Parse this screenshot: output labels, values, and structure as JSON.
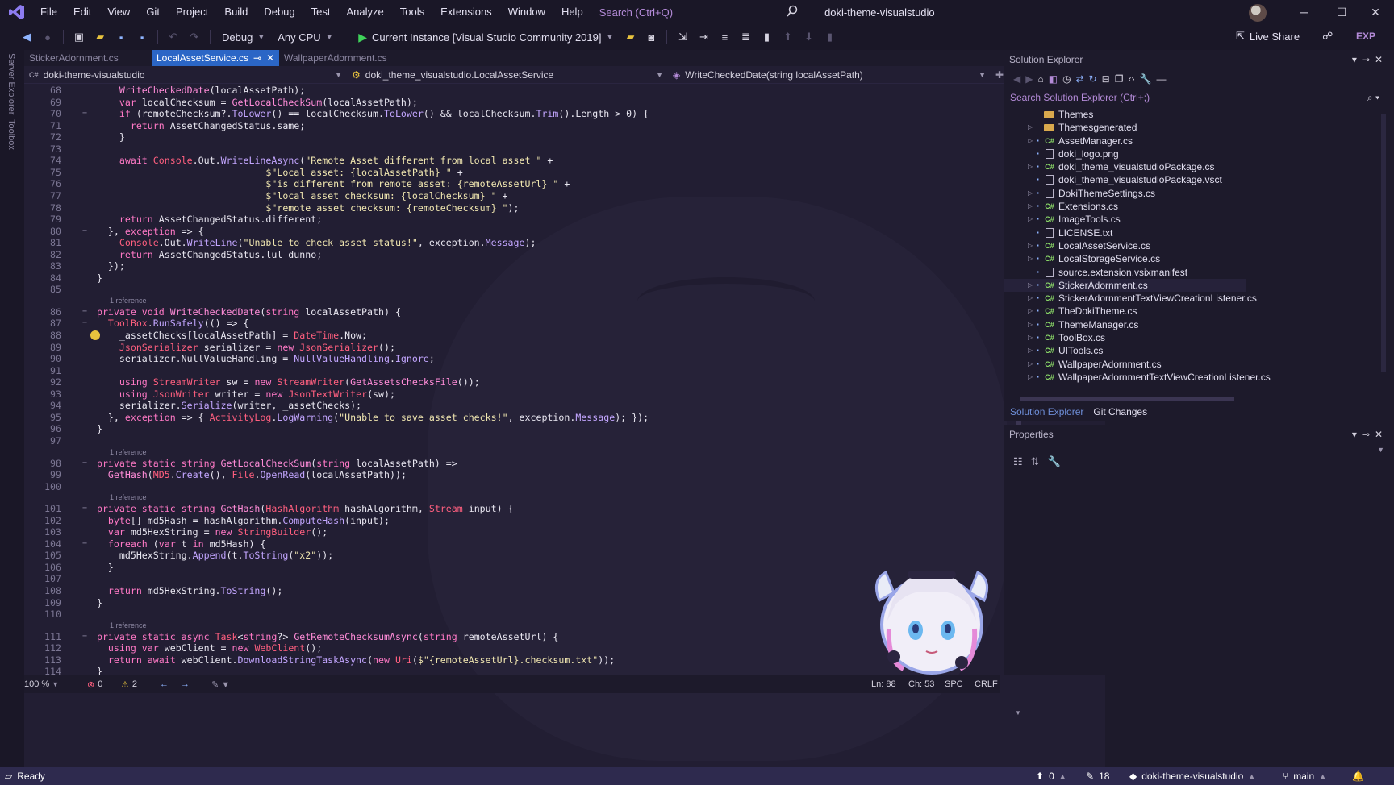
{
  "title_bar": {
    "menu": [
      "File",
      "Edit",
      "View",
      "Git",
      "Project",
      "Build",
      "Debug",
      "Test",
      "Analyze",
      "Tools",
      "Extensions",
      "Window",
      "Help"
    ],
    "search_placeholder": "Search (Ctrl+Q)",
    "solution_name": "doki-theme-visualstudio",
    "controls": {
      "minimize": "─",
      "maximize": "☐",
      "close": "✕"
    }
  },
  "toolbar": {
    "configuration": "Debug",
    "platform": "Any CPU",
    "run_target": "Current Instance [Visual Studio Community 2019]",
    "live_share": "Live Share",
    "exp_badge": "EXP"
  },
  "side_tabs": [
    "Server Explorer",
    "Toolbox"
  ],
  "editor": {
    "tabs": [
      {
        "label": "StickerAdornment.cs",
        "active": false
      },
      {
        "label": "LocalAssetService.cs",
        "active": true
      },
      {
        "label": "WallpaperAdornment.cs",
        "active": false
      }
    ],
    "nav": {
      "project": "doki-theme-visualstudio",
      "class": "doki_theme_visualstudio.LocalAssetService",
      "member": "WriteCheckedDate(string localAssetPath)"
    },
    "references_label": "1 reference",
    "lines": [
      {
        "n": "68",
        "html": "      <span class='fn'>WriteCheckedDate</span>(localAssetPath);"
      },
      {
        "n": "69",
        "html": "      <span class='kw'>var</span> localChecksum = <span class='fn'>GetLocalCheckSum</span>(localAssetPath);"
      },
      {
        "n": "70",
        "html": "      <span class='kw'>if</span> (remoteChecksum?.<span class='mm'>ToLower</span>() == localChecksum.<span class='mm'>ToLower</span>() &amp;&amp; localChecksum.<span class='mm'>Trim</span>().Length &gt; 0) {",
        "fold": true
      },
      {
        "n": "71",
        "html": "        <span class='kw'>return</span> AssetChangedStatus.same;"
      },
      {
        "n": "72",
        "html": "      }"
      },
      {
        "n": "73",
        "html": ""
      },
      {
        "n": "74",
        "html": "      <span class='kw'>await</span> <span class='ty'>Console</span>.Out.<span class='mm'>WriteLineAsync</span>(<span class='str'>\"Remote Asset different from local asset \"</span> +"
      },
      {
        "n": "75",
        "html": "                                <span class='str'>$\"Local asset: {localAssetPath} \"</span> +"
      },
      {
        "n": "76",
        "html": "                                <span class='str'>$\"is different from remote asset: {remoteAssetUrl} \"</span> +"
      },
      {
        "n": "77",
        "html": "                                <span class='str'>$\"local asset checksum: {localChecksum} \"</span> +"
      },
      {
        "n": "78",
        "html": "                                <span class='str'>$\"remote asset checksum: {remoteChecksum} \"</span>);"
      },
      {
        "n": "79",
        "html": "      <span class='kw'>return</span> AssetChangedStatus.different;"
      },
      {
        "n": "80",
        "html": "    }, <span class='kw'>exception</span> =&gt; {",
        "fold": true
      },
      {
        "n": "81",
        "html": "      <span class='ty'>Console</span>.Out.<span class='mm'>WriteLine</span>(<span class='str'>\"Unable to check asset status!\"</span>, exception.<span class='mm'>Message</span>);"
      },
      {
        "n": "82",
        "html": "      <span class='kw'>return</span> AssetChangedStatus.lul_dunno;"
      },
      {
        "n": "83",
        "html": "    });"
      },
      {
        "n": "84",
        "html": "  }"
      },
      {
        "n": "85",
        "html": ""
      },
      {
        "n": "86",
        "html": "  <span class='kw'>private void</span> <span class='fn'>WriteCheckedDate</span>(<span class='kw'>string</span> localAssetPath) {",
        "fold": true,
        "ref": true
      },
      {
        "n": "87",
        "html": "    <span class='ty'>ToolBox</span>.<span class='mm'>RunSafely</span>(() =&gt; {",
        "fold": true
      },
      {
        "n": "88",
        "html": "      _assetChecks[localAssetPath] = <span class='ty'>DateTime</span>.Now;",
        "bulb": true
      },
      {
        "n": "89",
        "html": "      <span class='ty'>JsonSerializer</span> serializer = <span class='kw'>new</span> <span class='ty'>JsonSerializer</span>();"
      },
      {
        "n": "90",
        "html": "      serializer.NullValueHandling = <span class='mm'>NullValueHandling</span>.<span class='mm'>Ignore</span>;"
      },
      {
        "n": "91",
        "html": ""
      },
      {
        "n": "92",
        "html": "      <span class='kw'>using</span> <span class='ty'>StreamWriter</span> sw = <span class='kw'>new</span> <span class='ty'>StreamWriter</span>(<span class='fn'>GetAssetsChecksFile</span>());"
      },
      {
        "n": "93",
        "html": "      <span class='kw'>using</span> <span class='ty'>JsonWriter</span> writer = <span class='kw'>new</span> <span class='ty'>JsonTextWriter</span>(sw);"
      },
      {
        "n": "94",
        "html": "      serializer.<span class='mm'>Serialize</span>(writer, _assetChecks);"
      },
      {
        "n": "95",
        "html": "    }, <span class='kw'>exception</span> =&gt; { <span class='ty'>ActivityLog</span>.<span class='mm'>LogWarning</span>(<span class='str'>\"Unable to save asset checks!\"</span>, exception.<span class='mm'>Message</span>); });"
      },
      {
        "n": "96",
        "html": "  }"
      },
      {
        "n": "97",
        "html": ""
      },
      {
        "n": "98",
        "html": "  <span class='kw'>private static string</span> <span class='fn'>GetLocalCheckSum</span>(<span class='kw'>string</span> localAssetPath) =&gt;",
        "fold": true,
        "ref": true
      },
      {
        "n": "99",
        "html": "    <span class='fn'>GetHash</span>(<span class='ty'>MD5</span>.<span class='mm'>Create</span>(), <span class='ty'>File</span>.<span class='mm'>OpenRead</span>(localAssetPath));"
      },
      {
        "n": "100",
        "html": ""
      },
      {
        "n": "101",
        "html": "  <span class='kw'>private static string</span> <span class='fn'>GetHash</span>(<span class='ty'>HashAlgorithm</span> hashAlgorithm, <span class='ty'>Stream</span> input) {",
        "fold": true,
        "ref": true
      },
      {
        "n": "102",
        "html": "    <span class='kw'>byte</span>[] md5Hash = hashAlgorithm.<span class='mm'>ComputeHash</span>(input);"
      },
      {
        "n": "103",
        "html": "    <span class='kw'>var</span> md5HexString = <span class='kw'>new</span> <span class='ty'>StringBuilder</span>();"
      },
      {
        "n": "104",
        "html": "    <span class='kw'>foreach</span> (<span class='kw'>var</span> t <span class='kw'>in</span> md5Hash) {",
        "fold": true
      },
      {
        "n": "105",
        "html": "      md5HexString.<span class='mm'>Append</span>(t.<span class='mm'>ToString</span>(<span class='str'>\"x2\"</span>));"
      },
      {
        "n": "106",
        "html": "    }"
      },
      {
        "n": "107",
        "html": ""
      },
      {
        "n": "108",
        "html": "    <span class='kw'>return</span> md5HexString.<span class='mm'>ToString</span>();"
      },
      {
        "n": "109",
        "html": "  }"
      },
      {
        "n": "110",
        "html": ""
      },
      {
        "n": "111",
        "html": "  <span class='kw'>private static async</span> <span class='ty'>Task</span>&lt;<span class='kw'>string</span>?&gt; <span class='fn'>GetRemoteChecksumAsync</span>(<span class='kw'>string</span> remoteAssetUrl) {",
        "fold": true,
        "ref": true
      },
      {
        "n": "112",
        "html": "    <span class='kw'>using var</span> webClient = <span class='kw'>new</span> <span class='ty'>WebClient</span>();"
      },
      {
        "n": "113",
        "html": "    <span class='kw'>return await</span> webClient.<span class='mm'>DownloadStringTaskAsync</span>(<span class='kw'>new</span> <span class='ty'>Uri</span>(<span class='str'>$\"{remoteAssetUrl}.checksum.txt\"</span>));"
      },
      {
        "n": "114",
        "html": "  }"
      }
    ],
    "zoom": "100 %",
    "errors": "0",
    "warnings": "2",
    "position": {
      "ln": "Ln: 88",
      "ch": "Ch: 53",
      "spc": "SPC",
      "eol": "CRLF"
    }
  },
  "solution_explorer": {
    "title": "Solution Explorer",
    "search_placeholder": "Search Solution Explorer (Ctrl+;)",
    "items": [
      {
        "label": "Themes",
        "kind": "folder",
        "arrow": false
      },
      {
        "label": "Themesgenerated",
        "kind": "folder",
        "arrow": true
      },
      {
        "label": "AssetManager.cs",
        "kind": "cs",
        "arrow": true
      },
      {
        "label": "doki_logo.png",
        "kind": "file",
        "arrow": false
      },
      {
        "label": "doki_theme_visualstudioPackage.cs",
        "kind": "cs",
        "arrow": true
      },
      {
        "label": "doki_theme_visualstudioPackage.vsct",
        "kind": "file",
        "arrow": false
      },
      {
        "label": "DokiThemeSettings.cs",
        "kind": "file",
        "arrow": true
      },
      {
        "label": "Extensions.cs",
        "kind": "cs",
        "arrow": true
      },
      {
        "label": "ImageTools.cs",
        "kind": "cs",
        "arrow": true
      },
      {
        "label": "LICENSE.txt",
        "kind": "file",
        "arrow": false
      },
      {
        "label": "LocalAssetService.cs",
        "kind": "cs",
        "arrow": true
      },
      {
        "label": "LocalStorageService.cs",
        "kind": "cs",
        "arrow": true
      },
      {
        "label": "source.extension.vsixmanifest",
        "kind": "file",
        "arrow": false
      },
      {
        "label": "StickerAdornment.cs",
        "kind": "cs",
        "arrow": true,
        "selected": true
      },
      {
        "label": "StickerAdornmentTextViewCreationListener.cs",
        "kind": "cs",
        "arrow": true
      },
      {
        "label": "TheDokiTheme.cs",
        "kind": "cs",
        "arrow": true
      },
      {
        "label": "ThemeManager.cs",
        "kind": "cs",
        "arrow": true
      },
      {
        "label": "ToolBox.cs",
        "kind": "cs",
        "arrow": true
      },
      {
        "label": "UITools.cs",
        "kind": "cs",
        "arrow": true
      },
      {
        "label": "WallpaperAdornment.cs",
        "kind": "cs",
        "arrow": true
      },
      {
        "label": "WallpaperAdornmentTextViewCreationListener.cs",
        "kind": "cs",
        "arrow": true
      }
    ],
    "bottom_tabs": [
      "Solution Explorer",
      "Git Changes"
    ]
  },
  "properties": {
    "title": "Properties"
  },
  "status_bar": {
    "ready": "Ready",
    "up_count": "0",
    "edits": "18",
    "repo": "doki-theme-visualstudio",
    "branch": "main"
  },
  "colors": {
    "accent": "#2b66c6",
    "keyword": "#ff79c6",
    "status_bar": "#2e2a4e"
  }
}
